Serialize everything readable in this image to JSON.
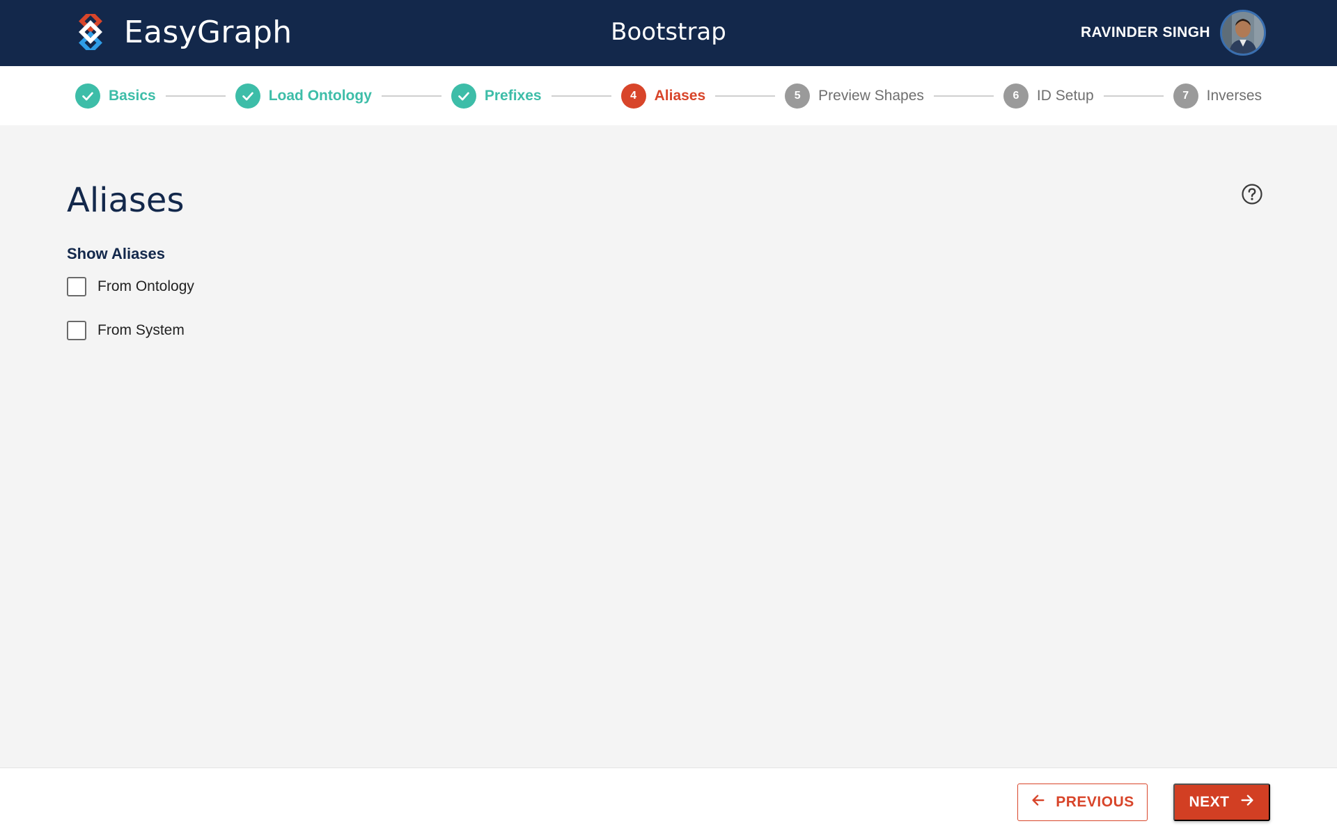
{
  "header": {
    "brand_name": "EasyGraph",
    "app_title": "Bootstrap",
    "user_name": "RAVINDER SINGH",
    "logo_icon": "easygraph-logo-icon",
    "avatar_icon": "user-avatar"
  },
  "stepper": {
    "steps": [
      {
        "number": "1",
        "label": "Basics",
        "status": "done"
      },
      {
        "number": "2",
        "label": "Load Ontology",
        "status": "done"
      },
      {
        "number": "3",
        "label": "Prefixes",
        "status": "done"
      },
      {
        "number": "4",
        "label": "Aliases",
        "status": "active"
      },
      {
        "number": "5",
        "label": "Preview Shapes",
        "status": "pending"
      },
      {
        "number": "6",
        "label": "ID Setup",
        "status": "pending"
      },
      {
        "number": "7",
        "label": "Inverses",
        "status": "pending"
      }
    ]
  },
  "main": {
    "title": "Aliases",
    "help_icon": "help-circle-icon",
    "section_label": "Show Aliases",
    "options": [
      {
        "label": "From Ontology",
        "checked": false
      },
      {
        "label": "From System",
        "checked": false
      }
    ]
  },
  "footer": {
    "previous_label": "PREVIOUS",
    "next_label": "NEXT"
  },
  "colors": {
    "header_bg": "#13284b",
    "done": "#3dbda8",
    "active": "#d8452a",
    "pending": "#9a9a9a",
    "page_bg": "#f4f4f4"
  }
}
